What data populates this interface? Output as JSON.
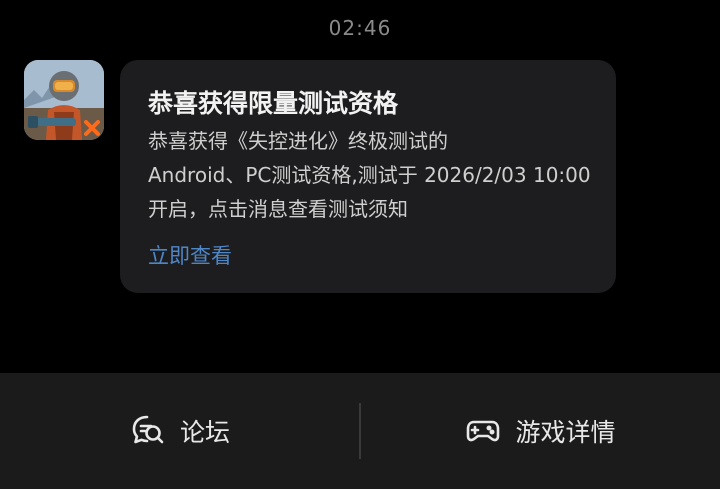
{
  "timestamp": "02:46",
  "notification": {
    "app_icon": "game-app-icon",
    "title": "恭喜获得限量测试资格",
    "body_lines": [
      "恭喜获得《失控进化》终极测试的",
      "Android、PC测试资格,测试于 2026/2/03 10:00",
      "开启，点击消息查看测试须知"
    ],
    "link_label": "立即查看",
    "link_color": "#4f86c6"
  },
  "bottom_bar": {
    "forum": {
      "icon": "chat-search-icon",
      "label": "论坛"
    },
    "details": {
      "icon": "gamepad-icon",
      "label": "游戏详情"
    }
  }
}
